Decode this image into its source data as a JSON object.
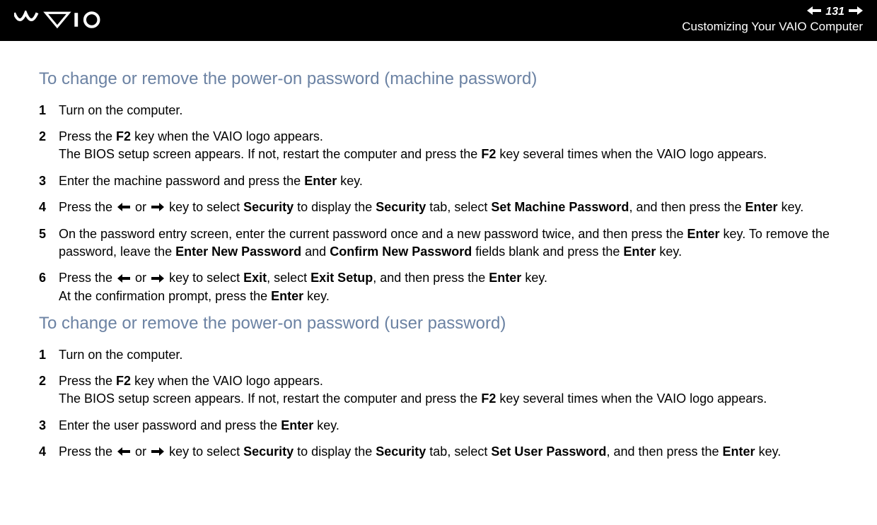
{
  "header": {
    "page_number": "131",
    "section_title": "Customizing Your VAIO Computer"
  },
  "section1": {
    "heading": "To change or remove the power-on password (machine password)",
    "steps": {
      "s1": "Turn on the computer.",
      "s2a": "Press the ",
      "s2b": "F2",
      "s2c": " key when the VAIO logo appears.",
      "s2d": "The BIOS setup screen appears. If not, restart the computer and press the ",
      "s2e": "F2",
      "s2f": " key several times when the VAIO logo appears.",
      "s3a": "Enter the machine password and press the ",
      "s3b": "Enter",
      "s3c": " key.",
      "s4a": "Press the ",
      "s4b": " or ",
      "s4c": " key to select ",
      "s4d": "Security",
      "s4e": " to display the ",
      "s4f": "Security",
      "s4g": " tab, select ",
      "s4h": "Set Machine Password",
      "s4i": ", and then press the ",
      "s4j": "Enter",
      "s4k": " key.",
      "s5a": "On the password entry screen, enter the current password once and a new password twice, and then press the ",
      "s5b": "Enter",
      "s5c": " key. To remove the password, leave the ",
      "s5d": "Enter New Password",
      "s5e": " and ",
      "s5f": "Confirm New Password",
      "s5g": " fields blank and press the ",
      "s5h": "Enter",
      "s5i": " key.",
      "s6a": "Press the ",
      "s6b": " or ",
      "s6c": " key to select ",
      "s6d": "Exit",
      "s6e": ", select ",
      "s6f": "Exit Setup",
      "s6g": ", and then press the ",
      "s6h": "Enter",
      "s6i": " key.",
      "s6j": "At the confirmation prompt, press the ",
      "s6k": "Enter",
      "s6l": " key."
    }
  },
  "section2": {
    "heading": "To change or remove the power-on password (user password)",
    "steps": {
      "s1": "Turn on the computer.",
      "s2a": "Press the ",
      "s2b": "F2",
      "s2c": " key when the VAIO logo appears.",
      "s2d": "The BIOS setup screen appears. If not, restart the computer and press the ",
      "s2e": "F2",
      "s2f": " key several times when the VAIO logo appears.",
      "s3a": "Enter the user password and press the ",
      "s3b": "Enter",
      "s3c": " key.",
      "s4a": "Press the ",
      "s4b": " or ",
      "s4c": " key to select ",
      "s4d": "Security",
      "s4e": " to display the ",
      "s4f": "Security",
      "s4g": " tab, select ",
      "s4h": "Set User Password",
      "s4i": ", and then press the ",
      "s4j": "Enter",
      "s4k": " key."
    }
  }
}
